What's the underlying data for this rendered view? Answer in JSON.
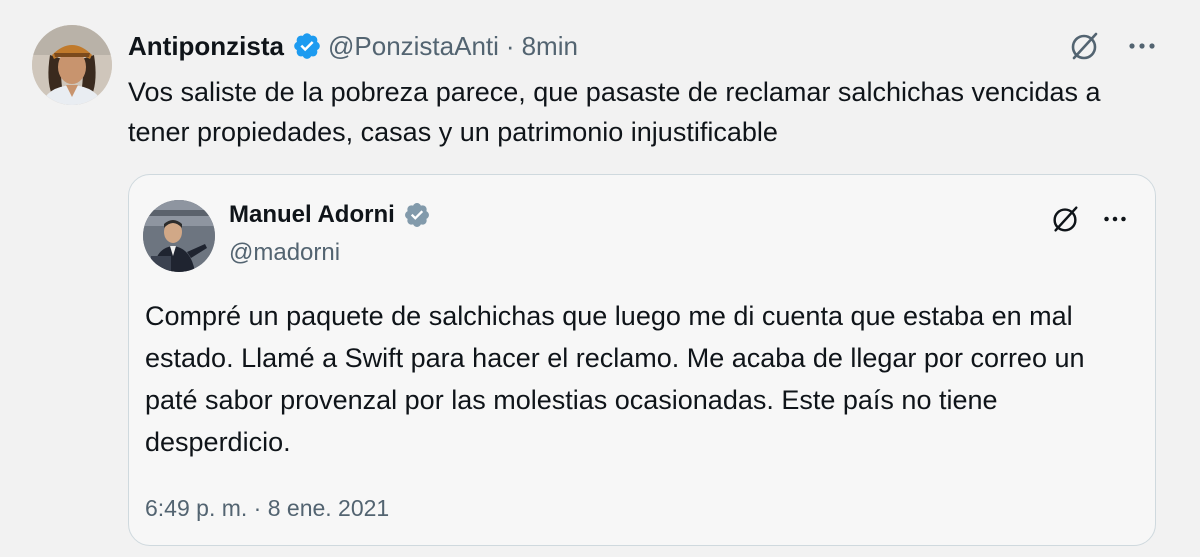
{
  "tweet": {
    "author_name": "Antiponzista",
    "author_handle": "@PonzistaAnti",
    "separator": "·",
    "time": "8min",
    "text": "Vos saliste de la pobreza parece, que pasaste de reclamar salchichas vencidas a tener propiedades, casas y un patrimonio injustificable",
    "verified_color": "#1d9bf0",
    "icons": {
      "grok": "grok-slash-circle-icon",
      "more": "more-horizontal-icon"
    }
  },
  "quote": {
    "author_name": "Manuel Adorni",
    "author_handle": "@madorni",
    "verified_color": "#829aab",
    "text": "Compré un paquete de salchichas que luego me di cuenta que estaba en mal estado. Llamé a Swift para hacer el reclamo. Me acaba de llegar por correo un paté sabor provenzal por las molestias ocasionadas. Este país no tiene desperdicio.",
    "date": "6:49 p. m. · 8 ene. 2021",
    "icons": {
      "grok": "grok-slash-circle-icon",
      "more": "more-horizontal-icon"
    }
  },
  "colors": {
    "background": "#f2f2f2",
    "text_primary": "#0f1419",
    "text_secondary": "#536471",
    "card_border": "#cfd9de"
  }
}
